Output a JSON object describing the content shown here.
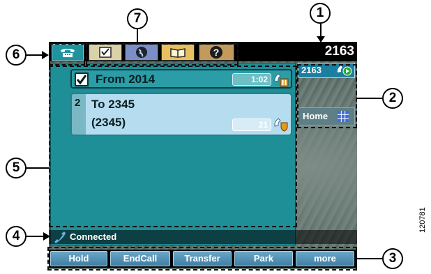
{
  "header": {
    "line_number": "2163"
  },
  "app_tabs": [
    {
      "name": "services",
      "icon": "checklist-icon"
    },
    {
      "name": "directories",
      "icon": "globe-icon"
    },
    {
      "name": "messages",
      "icon": "book-icon"
    },
    {
      "name": "help",
      "icon": "question-icon"
    }
  ],
  "calls": [
    {
      "label": "From 2014",
      "timer": "1:02",
      "state": "held"
    },
    {
      "index": "2",
      "line1": "To 2345",
      "line2": "(2345)",
      "timer": "21",
      "state": "active"
    }
  ],
  "line_panel": {
    "number": "2163",
    "home_label": "Home"
  },
  "status": {
    "text": "Connected"
  },
  "softkeys": [
    "Hold",
    "EndCall",
    "Transfer",
    "Park",
    "more"
  ],
  "callouts": [
    "1",
    "2",
    "3",
    "4",
    "5",
    "6",
    "7"
  ],
  "figure_id": "120781",
  "colors": {
    "call_area": "#1e8e97",
    "active_call": "#b6dcef",
    "softkey": "#4f8fb5",
    "header": "#000000"
  }
}
